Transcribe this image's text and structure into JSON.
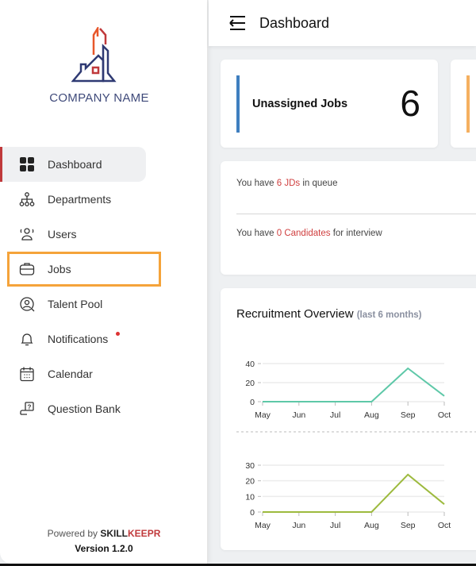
{
  "logo": {
    "text": "COMPANY NAME"
  },
  "sidebar": {
    "items": [
      {
        "label": "Dashboard",
        "icon": "grid-icon",
        "active": true
      },
      {
        "label": "Departments",
        "icon": "org-chart-icon"
      },
      {
        "label": "Users",
        "icon": "users-icon"
      },
      {
        "label": "Jobs",
        "icon": "briefcase-icon",
        "highlighted": true
      },
      {
        "label": "Talent Pool",
        "icon": "user-search-icon"
      },
      {
        "label": "Notifications",
        "icon": "bell-icon",
        "badge": true
      },
      {
        "label": "Calendar",
        "icon": "calendar-icon"
      },
      {
        "label": "Question Bank",
        "icon": "question-chat-icon"
      }
    ]
  },
  "footer": {
    "powered": "Powered by",
    "brand1": "SKILL",
    "brand2": "KEEPR",
    "version": "Version 1.2.0"
  },
  "header": {
    "title": "Dashboard"
  },
  "stat": {
    "label": "Unassigned Jobs",
    "value": "6",
    "accent": "#3f7fbf",
    "accent2": "#f5b060"
  },
  "queue": {
    "l1a": "You have ",
    "l1b": "6 JDs",
    "l1c": " in queue",
    "l2a": "You have ",
    "l2b": "0 Candidates",
    "l2c": " for interview"
  },
  "overview": {
    "title": "Recruitment Overview",
    "sub": "(last 6 months)"
  },
  "chart_data": [
    {
      "type": "line",
      "categories": [
        "May",
        "Jun",
        "Jul",
        "Aug",
        "Sep",
        "Oct"
      ],
      "values": [
        0,
        0,
        0,
        0,
        35,
        6
      ],
      "yticks": [
        0,
        20,
        40
      ],
      "ylim": [
        0,
        40
      ],
      "color": "#5ec8a8",
      "grid": true
    },
    {
      "type": "line",
      "categories": [
        "May",
        "Jun",
        "Jul",
        "Aug",
        "Sep",
        "Oct"
      ],
      "values": [
        0,
        0,
        0,
        0,
        24,
        5
      ],
      "yticks": [
        0,
        10,
        20,
        30
      ],
      "ylim": [
        0,
        30
      ],
      "color": "#9dba3e",
      "grid": true
    }
  ]
}
